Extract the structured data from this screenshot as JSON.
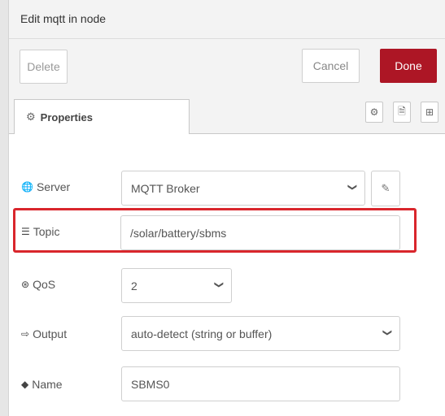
{
  "header": {
    "title": "Edit mqtt in node"
  },
  "toolbar": {
    "delete_label": "Delete",
    "cancel_label": "Cancel",
    "done_label": "Done"
  },
  "tabs": {
    "properties_label": "Properties"
  },
  "icons": {
    "gear": "⚙",
    "document": "🗎",
    "layout": "⊞"
  },
  "form": {
    "server": {
      "label": "Server",
      "value": "MQTT Broker"
    },
    "topic": {
      "label": "Topic",
      "value": "/solar/battery/sbms"
    },
    "qos": {
      "label": "QoS",
      "value": "2"
    },
    "output": {
      "label": "Output",
      "value": "auto-detect (string or buffer)"
    },
    "name": {
      "label": "Name",
      "value": "SBMS0"
    }
  },
  "colors": {
    "done": "#ad1625",
    "highlight": "#d9262c"
  }
}
